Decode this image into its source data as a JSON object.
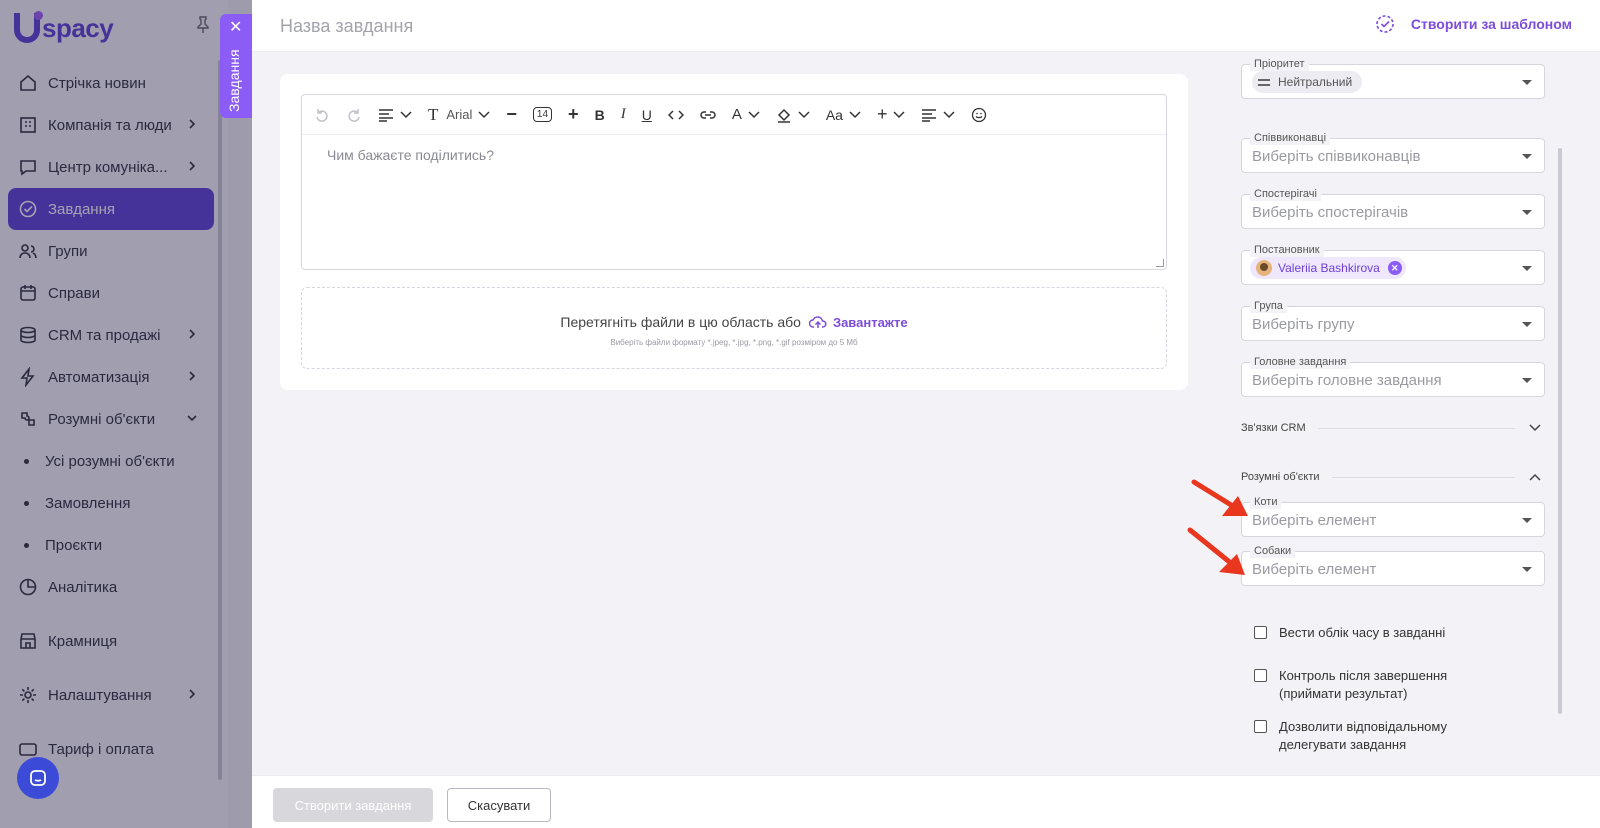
{
  "brand": {
    "logo_text": "spacy"
  },
  "sidebar": {
    "items": [
      {
        "label": "Стрічка новин",
        "icon": "home-icon",
        "chevron": false
      },
      {
        "label": "Компанія та люди",
        "icon": "company-icon",
        "chevron": true
      },
      {
        "label": "Центр комуніка...",
        "icon": "chat-icon",
        "chevron": true
      },
      {
        "label": "Завдання",
        "icon": "task-check-icon",
        "chevron": false,
        "active": true
      },
      {
        "label": "Групи",
        "icon": "groups-icon",
        "chevron": false
      },
      {
        "label": "Справи",
        "icon": "calendar-icon",
        "chevron": false
      },
      {
        "label": "CRM та продажі",
        "icon": "database-icon",
        "chevron": true
      },
      {
        "label": "Автоматизація",
        "icon": "lightning-icon",
        "chevron": true
      },
      {
        "label": "Розумні об'єкти",
        "icon": "smart-objects-icon",
        "chevron": true
      }
    ],
    "sub_items": [
      "Усі розумні об'єкти",
      "Замовлення",
      "Проєкти"
    ],
    "items_after": [
      {
        "label": "Аналітика",
        "icon": "analytics-icon",
        "chevron": false
      },
      {
        "label": "Крамниця",
        "icon": "store-icon",
        "chevron": false
      },
      {
        "label": "Налаштування",
        "icon": "gear-icon",
        "chevron": true
      },
      {
        "label": "Тариф і оплата",
        "icon": "tariff-icon",
        "chevron": false
      }
    ]
  },
  "side_tab": {
    "label": "Завдання",
    "close": "✕"
  },
  "header": {
    "title_placeholder": "Назва завдання",
    "template_button": "Створити за шаблоном"
  },
  "editor": {
    "font_name": "Arial",
    "font_size": "14",
    "case_label": "Aa",
    "placeholder": "Чим бажаєте поділитись?"
  },
  "dropzone": {
    "text": "Перетягніть файли в цю область або",
    "link": "Завантажте",
    "hint": "Виберіть файли формату *.jpeg, *.jpg, *.png, *.gif розміром до 5 Мб"
  },
  "fields": {
    "priority": {
      "label": "Пріоритет",
      "value": "Нейтральний"
    },
    "coexecutors": {
      "label": "Співвиконавці",
      "placeholder": "Виберіть співвиконавців"
    },
    "observers": {
      "label": "Спостерігачі",
      "placeholder": "Виберіть спостерігачів"
    },
    "creator": {
      "label": "Постановник",
      "value": "Valeriia Bashkirova"
    },
    "group": {
      "label": "Група",
      "placeholder": "Виберіть групу"
    },
    "parent_task": {
      "label": "Головне завдання",
      "placeholder": "Виберіть головне завдання"
    },
    "cats": {
      "label": "Коти",
      "placeholder": "Виберіть елемент"
    },
    "dogs": {
      "label": "Собаки",
      "placeholder": "Виберіть елемент"
    }
  },
  "sections": {
    "crm_links": "Зв'язки CRM",
    "smart_objects": "Розумні об'єкти"
  },
  "checkboxes": [
    {
      "label": "Вести облік часу в завданні"
    },
    {
      "label": "Контроль після завершення",
      "label2": "(приймати результат)"
    },
    {
      "label": "Дозволити відповідальному",
      "label2": "делегувати завдання"
    }
  ],
  "footer": {
    "create_button": "Створити завдання",
    "cancel_button": "Скасувати"
  },
  "colors": {
    "brand": "#5b3fd6",
    "accent": "#8b5cf6",
    "annotation_arrow": "#e8361f"
  }
}
